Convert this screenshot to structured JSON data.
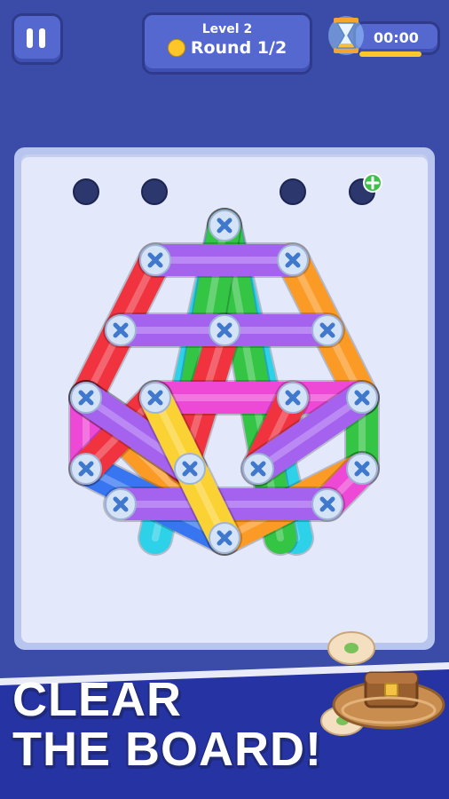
{
  "hud": {
    "level_label": "Level 2",
    "round_label": "Round 1/2",
    "timer": "00:00",
    "timer_progress": 1.0
  },
  "board": {
    "bar_colors": {
      "purple": "#a562ef",
      "red": "#f0333f",
      "orange": "#fb9a25",
      "yellow": "#fbd233",
      "green": "#34c545",
      "cyan": "#2dd1e8",
      "magenta": "#ee48d6",
      "blue": "#3876f1"
    },
    "empty_holes": 4,
    "add_hole_icon": "plus-icon"
  },
  "banner": {
    "headline": "CLEAR\nTHE BOARD!"
  },
  "colors": {
    "background": "#3b4ca8",
    "hud_button": "#5468d0",
    "board_frame": "#b8c6ef",
    "board_surface": "#e3e8fb",
    "banner": "#2633a3",
    "screw": "#d5e3f7",
    "screw_cross": "#3f78cc"
  }
}
